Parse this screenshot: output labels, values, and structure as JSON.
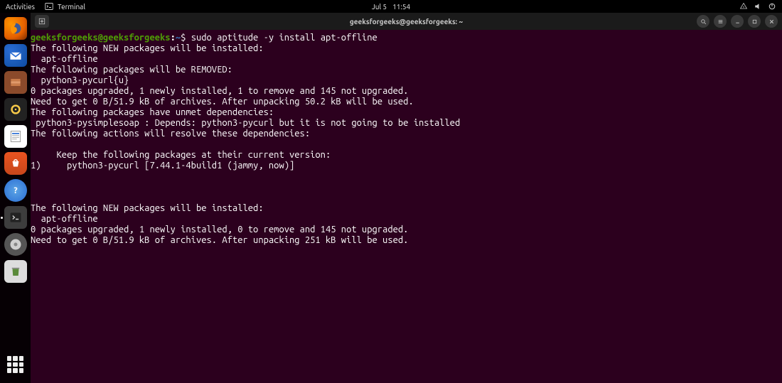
{
  "topbar": {
    "activities": "Activities",
    "app_label": "Terminal",
    "date": "Jul 5",
    "time": "11:54"
  },
  "titlebar": {
    "title": "geeksforgeeks@geeksforgeeks: ~"
  },
  "prompt": {
    "user_host": "geeksforgeeks@geeksforgeeks",
    "path": "~",
    "symbol": "$",
    "command": "sudo aptitude -y install apt-offline"
  },
  "output": {
    "l1": "The following NEW packages will be installed:",
    "l2": "  apt-offline ",
    "l3": "The following packages will be REMOVED:",
    "l4": "  python3-pycurl{u} ",
    "l5": "0 packages upgraded, 1 newly installed, 1 to remove and 145 not upgraded.",
    "l6": "Need to get 0 B/51.9 kB of archives. After unpacking 50.2 kB will be used.",
    "l7": "The following packages have unmet dependencies:",
    "l8": " python3-pysimplesoap : Depends: python3-pycurl but it is not going to be installed",
    "l9": "The following actions will resolve these dependencies:",
    "l10": "",
    "l11": "     Keep the following packages at their current version:",
    "l12": "1)     python3-pycurl [7.44.1-4build1 (jammy, now)]         ",
    "l13": "",
    "l14": "",
    "l15": "",
    "l16": "The following NEW packages will be installed:",
    "l17": "  apt-offline ",
    "l18": "0 packages upgraded, 1 newly installed, 0 to remove and 145 not upgraded.",
    "l19": "Need to get 0 B/51.9 kB of archives. After unpacking 251 kB will be used."
  },
  "dock": {
    "items": [
      "firefox",
      "thunderbird",
      "files",
      "rhythmbox",
      "libreoffice-writer",
      "ubuntu-software",
      "help",
      "terminal",
      "disk",
      "trash"
    ]
  }
}
